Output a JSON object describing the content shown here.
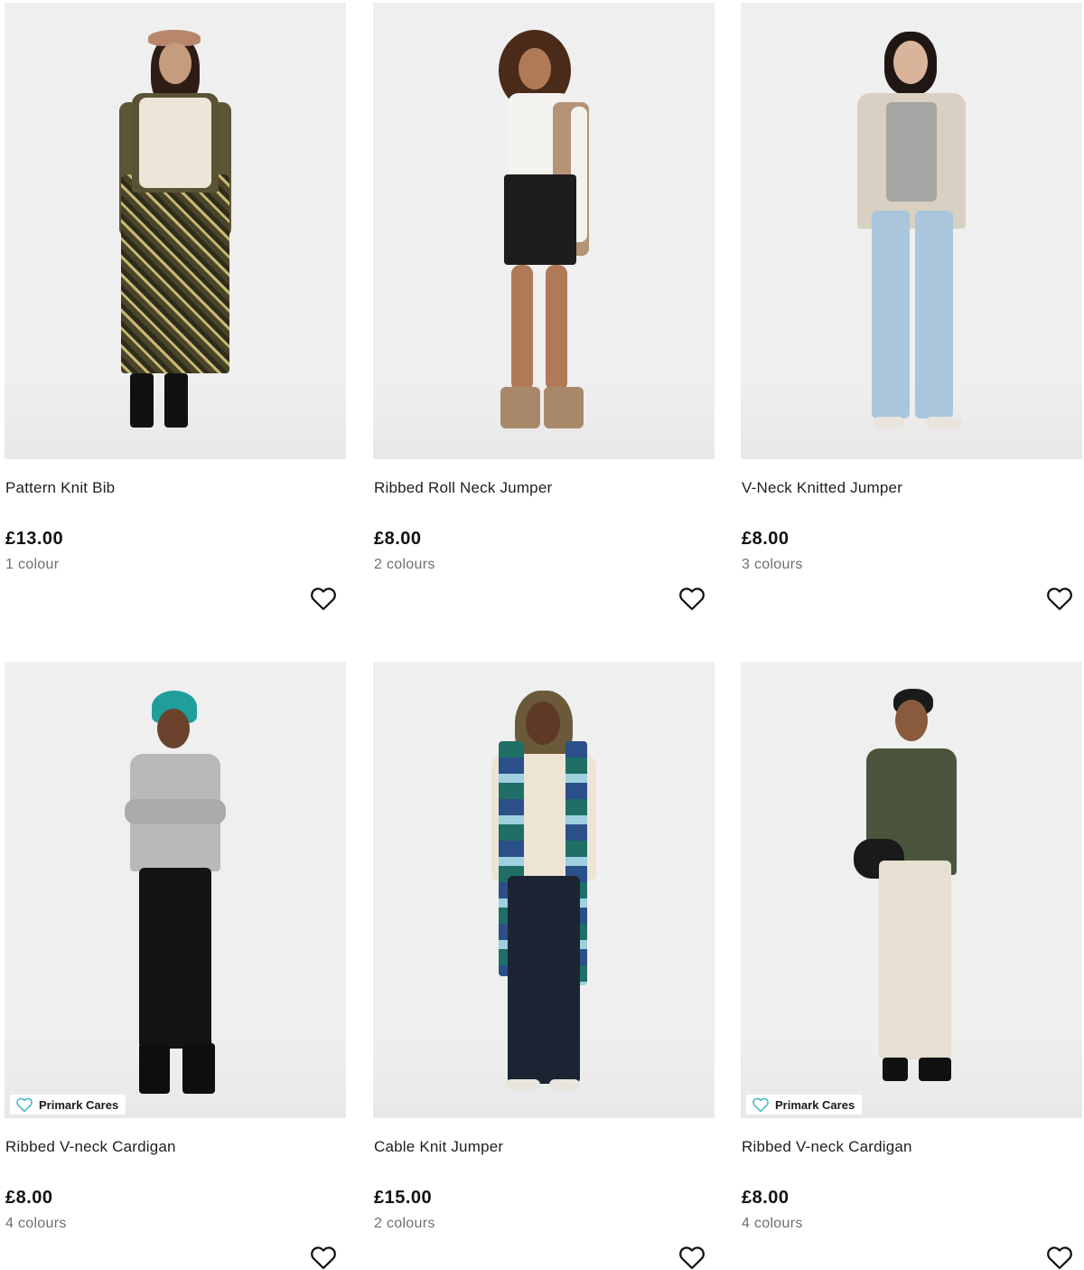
{
  "products": [
    {
      "name": "Pattern Knit Bib",
      "price": "£13.00",
      "colours": "1 colour",
      "badge": "",
      "image_alt": "Pattern Knit Bib"
    },
    {
      "name": "Ribbed Roll Neck Jumper",
      "price": "£8.00",
      "colours": "2 colours",
      "badge": "",
      "image_alt": "Ribbed Roll Neck Jumper"
    },
    {
      "name": "V-Neck Knitted Jumper",
      "price": "£8.00",
      "colours": "3 colours",
      "badge": "",
      "image_alt": "V-Neck Knitted Jumper"
    },
    {
      "name": "Ribbed V-neck Cardigan",
      "price": "£8.00",
      "colours": "4 colours",
      "badge": "Primark Cares",
      "image_alt": "Ribbed V-neck Cardigan"
    },
    {
      "name": "Cable Knit Jumper",
      "price": "£15.00",
      "colours": "2 colours",
      "badge": "",
      "image_alt": "Cable Knit Jumper"
    },
    {
      "name": "Ribbed V-neck Cardigan",
      "price": "£8.00",
      "colours": "4 colours",
      "badge": "Primark Cares",
      "image_alt": "Ribbed V-neck Cardigan"
    }
  ],
  "icons": {
    "wishlist": "heart-outline-icon",
    "badge": "heart-badge-icon"
  },
  "colors": {
    "badge_heart": "#3fb6c8",
    "price_text": "#111111",
    "muted_text": "#6e6e6e",
    "image_bg": "#efefef"
  }
}
